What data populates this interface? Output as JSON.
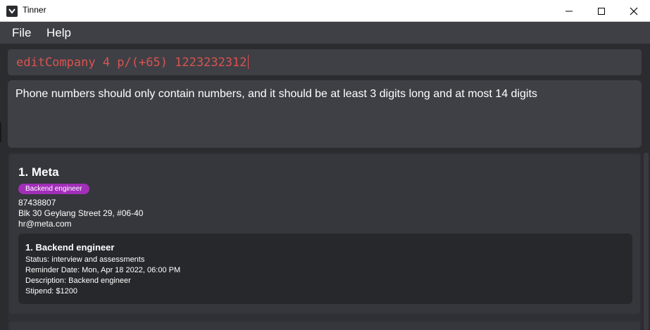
{
  "window": {
    "title": "Tinner",
    "icons": {
      "app": "app-logo-icon",
      "minimize": "minimize-icon",
      "maximize": "maximize-icon",
      "close": "close-icon"
    }
  },
  "menu": {
    "file": "File",
    "help": "Help"
  },
  "command": {
    "value": "editCompany 4 p/(+65) 1223232312"
  },
  "result": {
    "message": "Phone numbers should only contain numbers, and it should be at least 3 digits long and at most 14 digits"
  },
  "companies": [
    {
      "title": "1.  Meta",
      "tag": "Backend engineer",
      "phone": "87438807",
      "address": "Blk 30 Geylang Street 29, #06-40",
      "email": "hr@meta.com",
      "internships": [
        {
          "title": "1.  Backend engineer",
          "status": "Status: interview and assessments",
          "reminder": "Reminder Date: Mon, Apr 18 2022, 06:00 PM",
          "description": "Description: Backend engineer",
          "stipend": "Stipend: $1200"
        }
      ]
    }
  ],
  "colors": {
    "background": "#2b2c30",
    "panel": "#3f4046",
    "command_text": "#d9534f",
    "tag": "#a12fb8"
  }
}
